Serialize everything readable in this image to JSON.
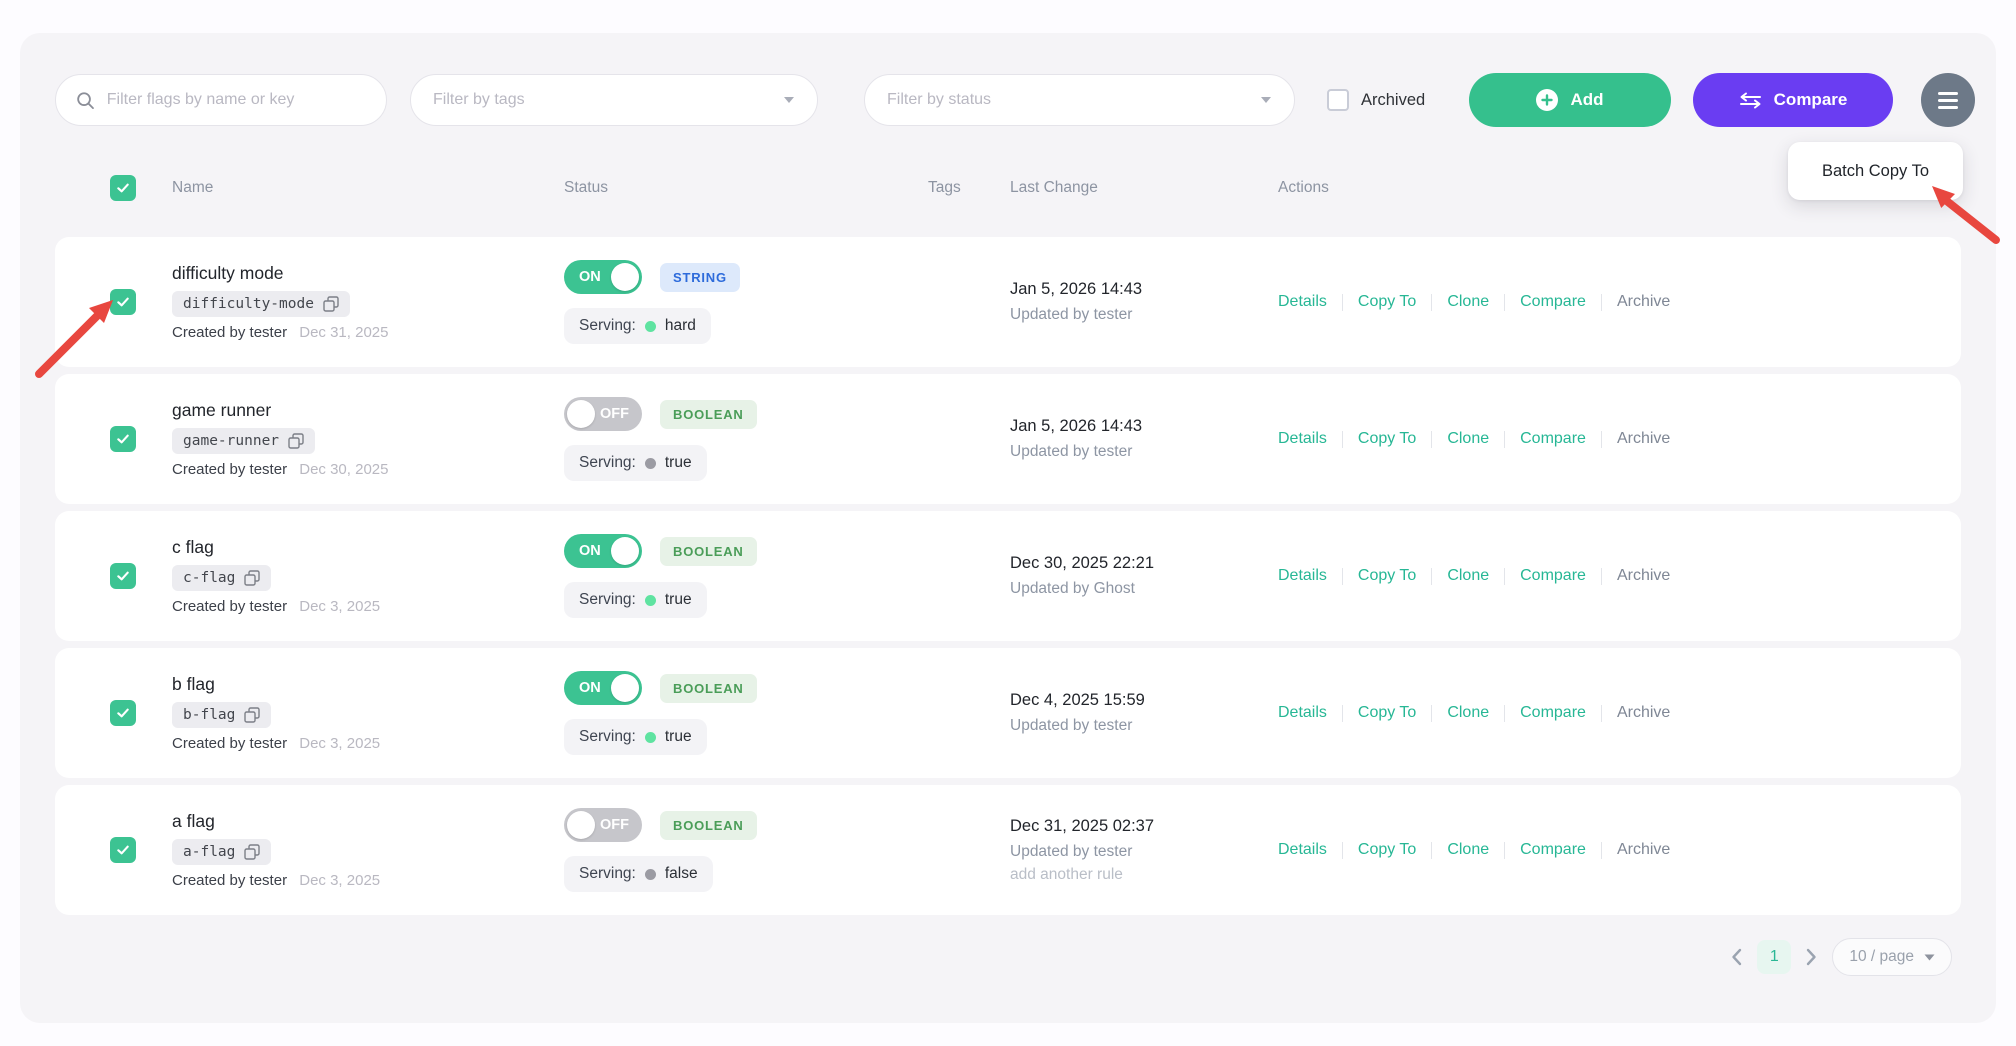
{
  "toolbar": {
    "search_placeholder": "Filter flags by name or key",
    "tags_placeholder": "Filter by tags",
    "status_placeholder": "Filter by status",
    "archived_label": "Archived",
    "add_label": "Add",
    "compare_label": "Compare"
  },
  "menu_popover": {
    "batch_copy_label": "Batch Copy To"
  },
  "table": {
    "headers": {
      "name": "Name",
      "status": "Status",
      "tags": "Tags",
      "last_change": "Last Change",
      "actions": "Actions"
    },
    "created_by_label": "Created by",
    "serving_label": "Serving:",
    "action_labels": {
      "details": "Details",
      "copy_to": "Copy To",
      "clone": "Clone",
      "compare": "Compare",
      "archive": "Archive"
    },
    "rows": [
      {
        "name": "difficulty mode",
        "key": "difficulty-mode",
        "created_by": "tester",
        "created_date": "Dec 31, 2025",
        "status": "ON",
        "status_on": true,
        "type": "STRING",
        "serving_value": "hard",
        "serving_on": true,
        "changed_at": "Jan 5, 2026 14:43",
        "updated_by": "Updated by tester",
        "extra": "",
        "checked": true
      },
      {
        "name": "game runner",
        "key": "game-runner",
        "created_by": "tester",
        "created_date": "Dec 30, 2025",
        "status": "OFF",
        "status_on": false,
        "type": "BOOLEAN",
        "serving_value": "true",
        "serving_on": false,
        "changed_at": "Jan 5, 2026 14:43",
        "updated_by": "Updated by tester",
        "extra": "",
        "checked": true
      },
      {
        "name": "c flag",
        "key": "c-flag",
        "created_by": "tester",
        "created_date": "Dec 3, 2025",
        "status": "ON",
        "status_on": true,
        "type": "BOOLEAN",
        "serving_value": "true",
        "serving_on": true,
        "changed_at": "Dec 30, 2025 22:21",
        "updated_by": "Updated by Ghost",
        "extra": "",
        "checked": true
      },
      {
        "name": "b flag",
        "key": "b-flag",
        "created_by": "tester",
        "created_date": "Dec 3, 2025",
        "status": "ON",
        "status_on": true,
        "type": "BOOLEAN",
        "serving_value": "true",
        "serving_on": true,
        "changed_at": "Dec 4, 2025 15:59",
        "updated_by": "Updated by tester",
        "extra": "",
        "checked": true
      },
      {
        "name": "a flag",
        "key": "a-flag",
        "created_by": "tester",
        "created_date": "Dec 3, 2025",
        "status": "OFF",
        "status_on": false,
        "type": "BOOLEAN",
        "serving_value": "false",
        "serving_on": false,
        "changed_at": "Dec 31, 2025 02:37",
        "updated_by": "Updated by tester",
        "extra": "add another rule",
        "checked": true
      }
    ]
  },
  "pagination": {
    "page": "1",
    "page_size": "10 / page"
  },
  "colors": {
    "panel_bg": "#f5f4f7",
    "green_accent": "#35c08d",
    "toggle_green": "#3cc392",
    "purple_accent": "#6a3df2",
    "menu_gray": "#6d7988",
    "teal_link": "#27b795",
    "string_badge_bg": "#dde9fb",
    "string_badge_text": "#2d6bdb",
    "boolean_badge_bg": "#e7f2e7",
    "boolean_badge_text": "#4a9d58",
    "annotation_red": "#e8473f"
  }
}
